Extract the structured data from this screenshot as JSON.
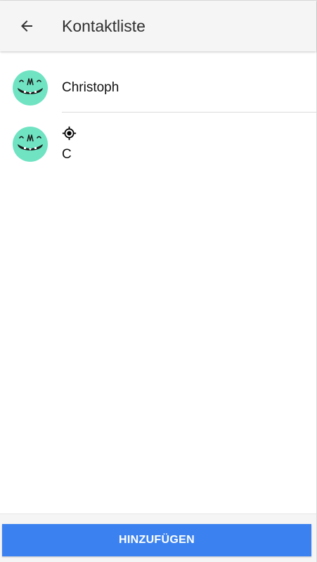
{
  "appbar": {
    "back_icon": "arrow-back-icon",
    "title": "Kontaktliste"
  },
  "contacts": [
    {
      "name": "Christoph",
      "avatar_icon": "monster-face-avatar",
      "avatar_color": "#6fe3c2"
    },
    {
      "name": "C",
      "avatar_icon": "monster-face-avatar",
      "avatar_color": "#6fe3c2",
      "status_icon": "location-target-icon"
    }
  ],
  "footer": {
    "add_label": "HINZUFÜGEN",
    "button_color": "#3b82f0"
  }
}
